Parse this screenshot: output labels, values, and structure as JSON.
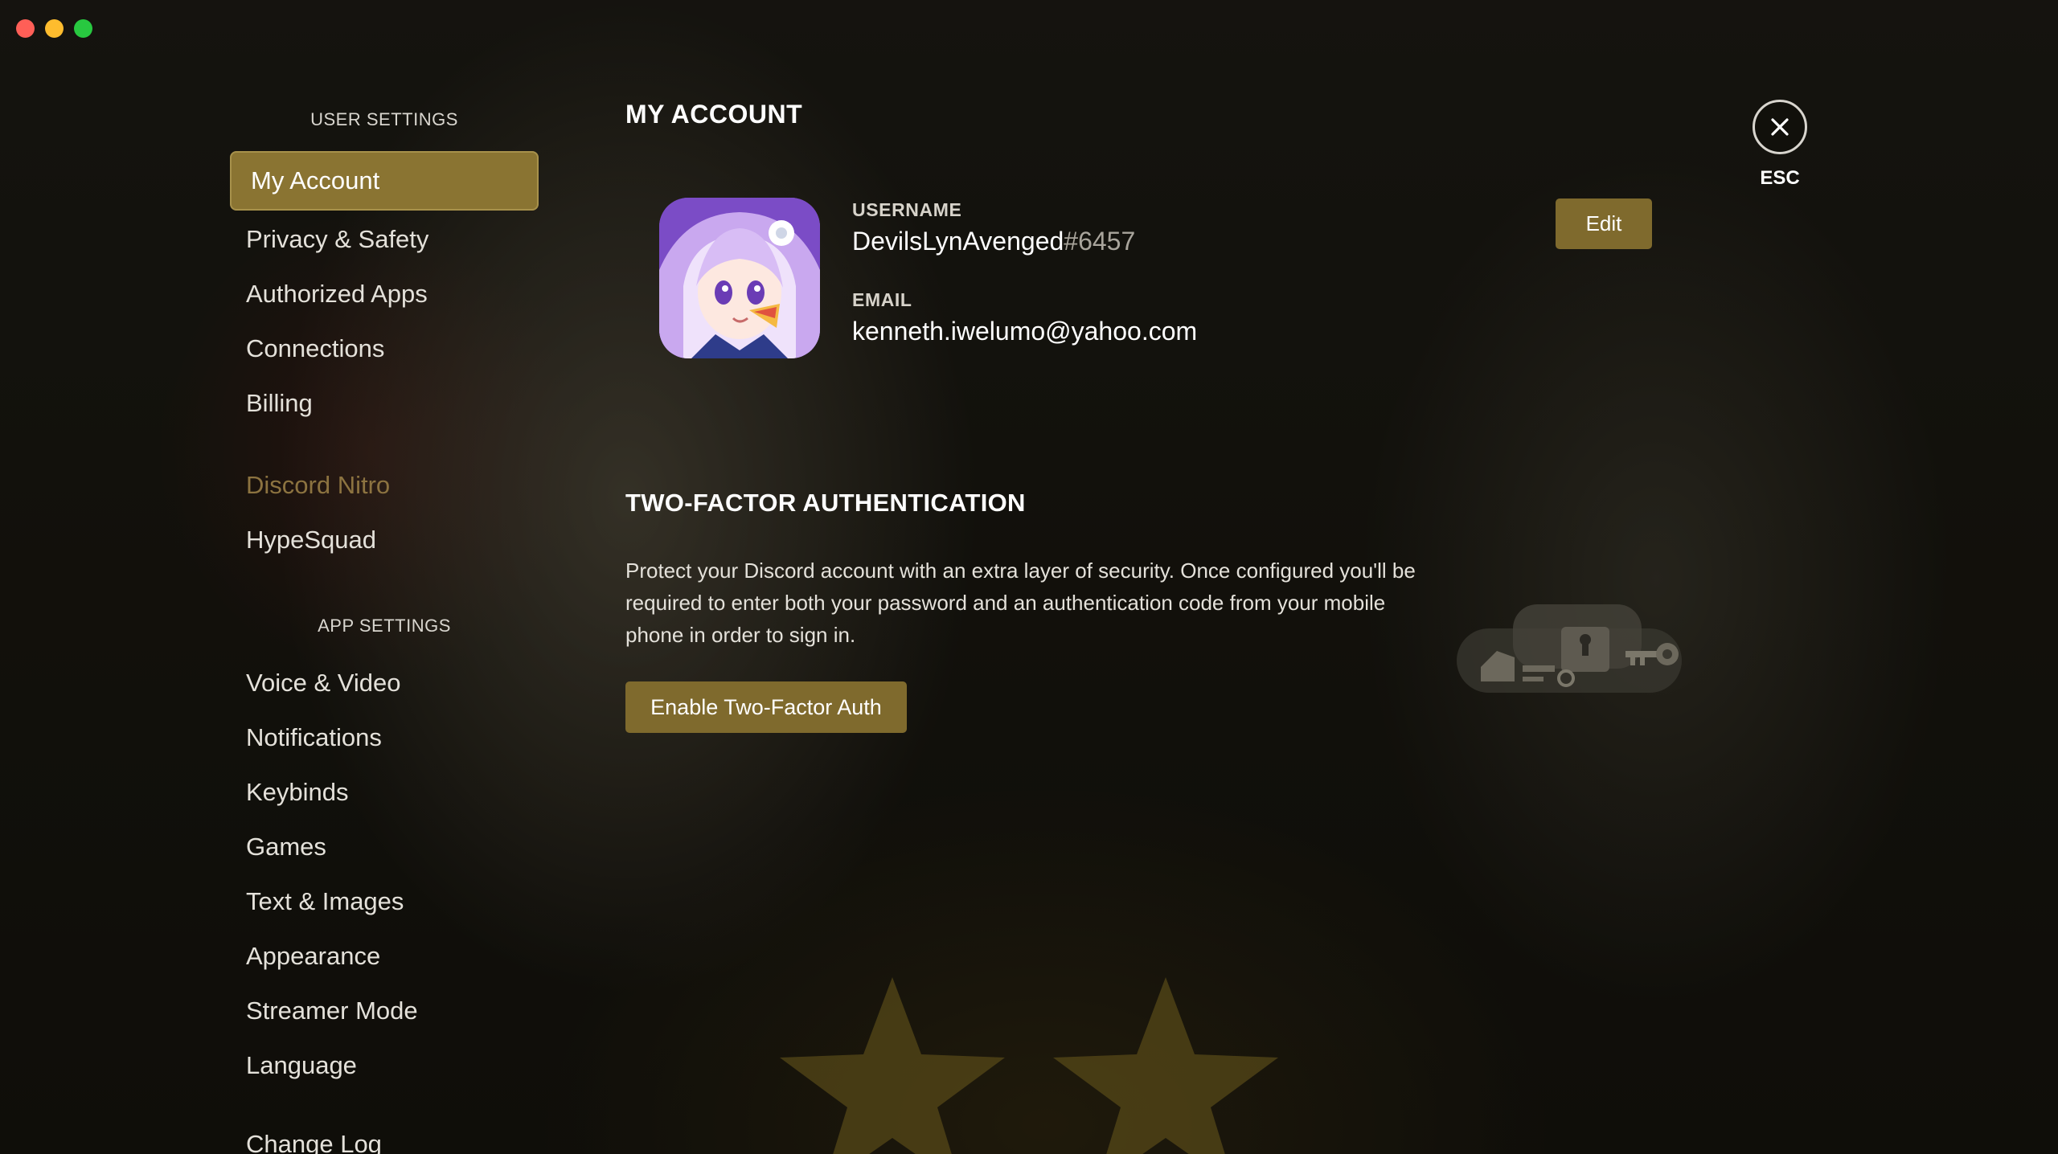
{
  "window": {
    "controls": [
      "close",
      "minimize",
      "maximize"
    ]
  },
  "sidebar": {
    "user_settings_header": "USER SETTINGS",
    "user_items": [
      {
        "label": "My Account",
        "selected": true
      },
      {
        "label": "Privacy & Safety"
      },
      {
        "label": "Authorized Apps"
      },
      {
        "label": "Connections"
      },
      {
        "label": "Billing"
      }
    ],
    "nitro_item": "Discord Nitro",
    "hypesquad_item": "HypeSquad",
    "app_settings_header": "APP SETTINGS",
    "app_items": [
      {
        "label": "Voice & Video"
      },
      {
        "label": "Notifications"
      },
      {
        "label": "Keybinds"
      },
      {
        "label": "Games"
      },
      {
        "label": "Text & Images"
      },
      {
        "label": "Appearance"
      },
      {
        "label": "Streamer Mode"
      },
      {
        "label": "Language"
      }
    ],
    "changelog_item": "Change Log"
  },
  "account": {
    "title": "MY ACCOUNT",
    "username_label": "USERNAME",
    "username": "DevilsLynAvenged",
    "discriminator": "#6457",
    "email_label": "EMAIL",
    "email": "kenneth.iwelumo@yahoo.com",
    "edit_label": "Edit"
  },
  "close": {
    "icon": "close-icon",
    "label": "ESC"
  },
  "two_factor": {
    "title": "TWO-FACTOR AUTHENTICATION",
    "description": "Protect your Discord account with an extra layer of security. Once configured you'll be required to enter both your password and an authentication code from your mobile phone in order to sign in.",
    "button_label": "Enable Two-Factor Auth",
    "illustration_icon": "lock-key-illustration"
  },
  "colors": {
    "accent": "#7f6a2d",
    "selected_bg": "#8a7432",
    "nitro_text": "#8c7340"
  }
}
